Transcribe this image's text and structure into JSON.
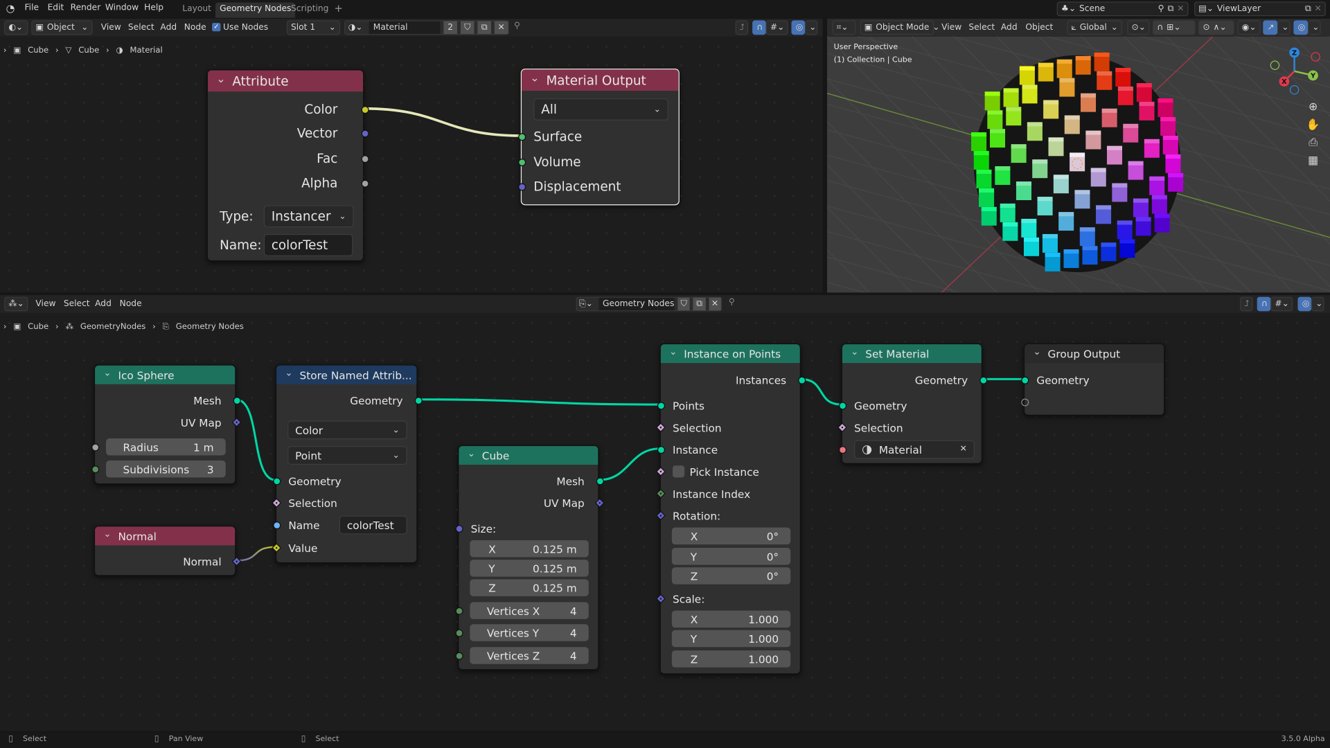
{
  "app": {
    "logo": "blender-logo",
    "version": "3.5.0 Alpha"
  },
  "menu": [
    "File",
    "Edit",
    "Render",
    "Window",
    "Help"
  ],
  "workspace_tabs": [
    {
      "label": "Layout",
      "active": false
    },
    {
      "label": "Geometry Nodes",
      "active": true
    },
    {
      "label": "Scripting",
      "active": false
    }
  ],
  "add_workspace": "+",
  "scene": {
    "label": "Scene"
  },
  "view_layer": {
    "label": "ViewLayer"
  },
  "shader_header": {
    "mode": "Object",
    "menus": [
      "View",
      "Select",
      "Add",
      "Node"
    ],
    "use_nodes": {
      "label": "Use Nodes",
      "checked": true
    },
    "slot": "Slot 1",
    "material": "Material",
    "users": "2"
  },
  "shader_breadcrumb": [
    "Cube",
    "Cube",
    "Material"
  ],
  "viewport": {
    "mode": "Object Mode",
    "menus": [
      "View",
      "Select",
      "Add",
      "Object"
    ],
    "orientation": "Global",
    "overlay_line1": "User Perspective",
    "overlay_line2": "(1) Collection | Cube",
    "gizmo": {
      "x": "X",
      "y": "Y",
      "z": "Z"
    },
    "axis_colors": {
      "x": "#e0394e",
      "y": "#8bc34a",
      "z": "#2e86de"
    }
  },
  "geo_header": {
    "menus": [
      "View",
      "Select",
      "Add",
      "Node"
    ],
    "node_group": "Geometry Nodes"
  },
  "geo_breadcrumb": [
    "Cube",
    "GeometryNodes",
    "Geometry Nodes"
  ],
  "colors": {
    "geometry": "#00d6a3",
    "vector": "#6363c7",
    "color": "#c7c729",
    "float": "#a1a1a1",
    "int": "#598c5c",
    "string": "#70b2ff",
    "boolean": "#cca6d6",
    "material": "#eb7582",
    "input_header": "#83314a",
    "geometry_header": "#1d725e",
    "attribute_header": "#1e3a5f",
    "output_header": "#83314a",
    "group_output_header": "#2a2a2a",
    "accent": "#4772b3"
  },
  "shader_editor": {
    "nodes": [
      {
        "id": "attribute",
        "title": "Attribute",
        "header_color": "#83314a",
        "rows": [
          {
            "type": "output",
            "label": "Color",
            "socket": "#c7c729"
          },
          {
            "type": "output",
            "label": "Vector",
            "socket": "#6363c7"
          },
          {
            "type": "output",
            "label": "Fac",
            "socket": "#a1a1a1"
          },
          {
            "type": "output",
            "label": "Alpha",
            "socket": "#a1a1a1"
          },
          {
            "type": "labeled_dropdown",
            "label": "Type:",
            "value": "Instancer"
          },
          {
            "type": "labeled_input",
            "label": "Name:",
            "value": "colorTest"
          }
        ]
      },
      {
        "id": "matout",
        "title": "Material Output",
        "header_color": "#83314a",
        "selected": true,
        "rows": [
          {
            "type": "dropdown",
            "value": "All"
          },
          {
            "type": "input",
            "label": "Surface",
            "socket": "#4dbf6e"
          },
          {
            "type": "input",
            "label": "Volume",
            "socket": "#4dbf6e"
          },
          {
            "type": "input",
            "label": "Displacement",
            "socket": "#6363c7"
          }
        ]
      }
    ]
  },
  "geometry_editor": {
    "nodes": [
      {
        "id": "ico",
        "title": "Ico Sphere",
        "header_color": "#1d725e",
        "rows": [
          {
            "type": "output",
            "label": "Mesh",
            "socket": "#00d6a3"
          },
          {
            "type": "output",
            "label": "UV Map",
            "socket": "#6363c7",
            "shape": "diamond"
          },
          {
            "type": "field",
            "label": "Radius",
            "value": "1 m",
            "socket": "#a1a1a1"
          },
          {
            "type": "field",
            "label": "Subdivisions",
            "value": "3",
            "socket": "#598c5c"
          }
        ]
      },
      {
        "id": "normal",
        "title": "Normal",
        "header_color": "#83314a",
        "rows": [
          {
            "type": "output",
            "label": "Normal",
            "socket": "#6363c7",
            "shape": "diamond"
          }
        ]
      },
      {
        "id": "store",
        "title": "Store Named Attrib...",
        "header_color": "#1e3a5f",
        "rows": [
          {
            "type": "output",
            "label": "Geometry",
            "socket": "#00d6a3"
          },
          {
            "type": "dropdown",
            "value": "Color"
          },
          {
            "type": "dropdown",
            "value": "Point"
          },
          {
            "type": "input",
            "label": "Geometry",
            "socket": "#00d6a3"
          },
          {
            "type": "input",
            "label": "Selection",
            "socket": "#cca6d6",
            "shape": "diamond"
          },
          {
            "type": "input_field",
            "label": "Name",
            "value": "colorTest",
            "socket": "#70b2ff"
          },
          {
            "type": "input",
            "label": "Value",
            "socket": "#c7c729",
            "shape": "diamond"
          }
        ]
      },
      {
        "id": "cube",
        "title": "Cube",
        "header_color": "#1d725e",
        "rows": [
          {
            "type": "output",
            "label": "Mesh",
            "socket": "#00d6a3"
          },
          {
            "type": "output",
            "label": "UV Map",
            "socket": "#6363c7",
            "shape": "diamond"
          },
          {
            "type": "input",
            "label": "Size:",
            "socket": "#6363c7"
          },
          {
            "type": "field",
            "label": "X",
            "value": "0.125 m"
          },
          {
            "type": "field",
            "label": "Y",
            "value": "0.125 m"
          },
          {
            "type": "field",
            "label": "Z",
            "value": "0.125 m"
          },
          {
            "type": "field",
            "label": "Vertices X",
            "value": "4",
            "socket": "#598c5c"
          },
          {
            "type": "field",
            "label": "Vertices Y",
            "value": "4",
            "socket": "#598c5c"
          },
          {
            "type": "field",
            "label": "Vertices Z",
            "value": "4",
            "socket": "#598c5c"
          }
        ]
      },
      {
        "id": "iop",
        "title": "Instance on Points",
        "header_color": "#1d725e",
        "rows": [
          {
            "type": "output",
            "label": "Instances",
            "socket": "#00d6a3"
          },
          {
            "type": "input",
            "label": "Points",
            "socket": "#00d6a3"
          },
          {
            "type": "input",
            "label": "Selection",
            "socket": "#cca6d6",
            "shape": "diamond"
          },
          {
            "type": "input",
            "label": "Instance",
            "socket": "#00d6a3"
          },
          {
            "type": "checkbox",
            "label": "Pick Instance",
            "socket": "#cca6d6",
            "shape": "diamond",
            "checked": false
          },
          {
            "type": "input",
            "label": "Instance Index",
            "socket": "#598c5c",
            "shape": "diamond"
          },
          {
            "type": "input",
            "label": "Rotation:",
            "socket": "#6363c7",
            "shape": "diamond"
          },
          {
            "type": "field",
            "label": "X",
            "value": "0°"
          },
          {
            "type": "field",
            "label": "Y",
            "value": "0°"
          },
          {
            "type": "field",
            "label": "Z",
            "value": "0°"
          },
          {
            "type": "input",
            "label": "Scale:",
            "socket": "#6363c7",
            "shape": "diamond"
          },
          {
            "type": "field",
            "label": "X",
            "value": "1.000"
          },
          {
            "type": "field",
            "label": "Y",
            "value": "1.000"
          },
          {
            "type": "field",
            "label": "Z",
            "value": "1.000"
          }
        ]
      },
      {
        "id": "setmat",
        "title": "Set Material",
        "header_color": "#1d725e",
        "rows": [
          {
            "type": "output",
            "label": "Geometry",
            "socket": "#00d6a3"
          },
          {
            "type": "input",
            "label": "Geometry",
            "socket": "#00d6a3"
          },
          {
            "type": "input",
            "label": "Selection",
            "socket": "#cca6d6",
            "shape": "diamond"
          },
          {
            "type": "material",
            "value": "Material",
            "socket": "#eb7582"
          }
        ]
      },
      {
        "id": "gout",
        "title": "Group Output",
        "header_color": "#2a2a2a",
        "rows": [
          {
            "type": "input",
            "label": "Geometry",
            "socket": "#00d6a3"
          },
          {
            "type": "empty"
          }
        ]
      }
    ]
  },
  "status_bar": [
    {
      "icon": "mouse-left-icon",
      "label": "Select"
    },
    {
      "icon": "mouse-middle-icon",
      "label": "Pan View"
    },
    {
      "icon": "mouse-right-icon",
      "label": "Select"
    }
  ]
}
